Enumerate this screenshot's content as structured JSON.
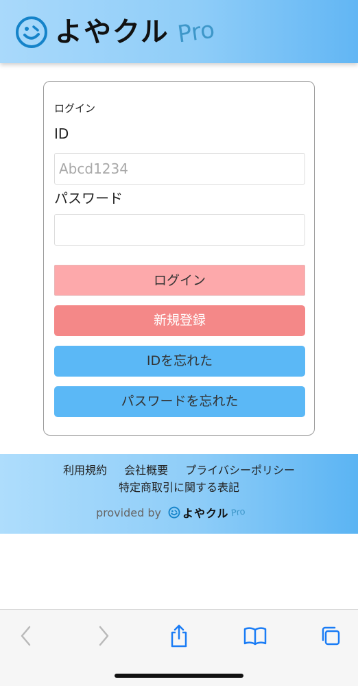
{
  "header": {
    "logo_text": "よやクル",
    "logo_suffix": "Pro"
  },
  "login_card": {
    "title": "ログイン",
    "id_label": "ID",
    "id_placeholder": "Abcd1234",
    "id_value": "",
    "password_label": "パスワード",
    "password_value": "",
    "login_button": "ログイン",
    "register_button": "新規登録",
    "forgot_id_button": "IDを忘れた",
    "forgot_password_button": "パスワードを忘れた"
  },
  "footer": {
    "links": [
      "利用規約",
      "会社概要",
      "プライバシーポリシー"
    ],
    "link_commerce": "特定商取引に関する表記",
    "provided_by": "provided by",
    "logo_text": "よやクル",
    "logo_suffix": "Pro"
  },
  "browser_toolbar": {
    "icons": [
      "back-icon",
      "forward-icon",
      "share-icon",
      "bookmarks-icon",
      "tabs-icon"
    ]
  },
  "colors": {
    "header_gradient_start": "#a9d9fb",
    "header_gradient_end": "#62b6f4",
    "login_button": "#fda9ab",
    "register_button": "#f48888",
    "forgot_buttons": "#5bb8f6",
    "safari_blue": "#1a7cf5"
  }
}
